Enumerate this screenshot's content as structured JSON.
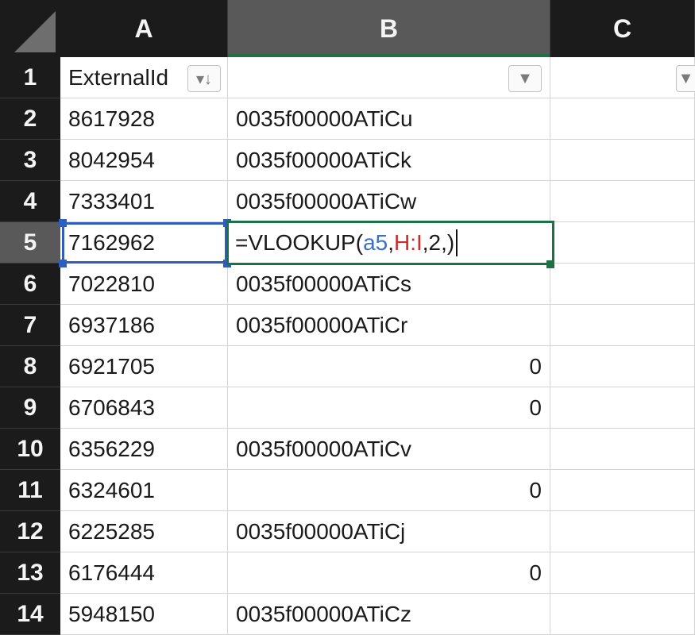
{
  "columns": [
    "A",
    "B",
    "C"
  ],
  "rows": [
    {
      "num": "1",
      "a": "ExternalId",
      "b": ""
    },
    {
      "num": "2",
      "a": "8617928",
      "b": "0035f00000ATiCu"
    },
    {
      "num": "3",
      "a": "8042954",
      "b": "0035f00000ATiCk"
    },
    {
      "num": "4",
      "a": "7333401",
      "b": "0035f00000ATiCw"
    },
    {
      "num": "5",
      "a": "7162962",
      "b": ""
    },
    {
      "num": "6",
      "a": "7022810",
      "b": "0035f00000ATiCs"
    },
    {
      "num": "7",
      "a": "6937186",
      "b": "0035f00000ATiCr"
    },
    {
      "num": "8",
      "a": "6921705",
      "b": "0"
    },
    {
      "num": "9",
      "a": "6706843",
      "b": "0"
    },
    {
      "num": "10",
      "a": "6356229",
      "b": "0035f00000ATiCv"
    },
    {
      "num": "11",
      "a": "6324601",
      "b": "0"
    },
    {
      "num": "12",
      "a": "6225285",
      "b": "0035f00000ATiCj"
    },
    {
      "num": "13",
      "a": "6176444",
      "b": "0"
    },
    {
      "num": "14",
      "a": "5948150",
      "b": "0035f00000ATiCz"
    }
  ],
  "edit_formula": {
    "prefix": "=VLOOKUP(",
    "ref1": "a5",
    "sep1": ",",
    "ref2": "H:I",
    "suffix": ",2,)"
  },
  "icons": {
    "filter_sorted": "filter-sort-desc-icon",
    "filter": "filter-dropdown-icon"
  },
  "colors": {
    "header_bg": "#1b1b1b",
    "selected_header_bg": "#595959",
    "edit_border": "#1e7145",
    "selection_border": "#2f5fbd",
    "ref_blue": "#3c6fc9",
    "ref_red": "#c9302c"
  }
}
